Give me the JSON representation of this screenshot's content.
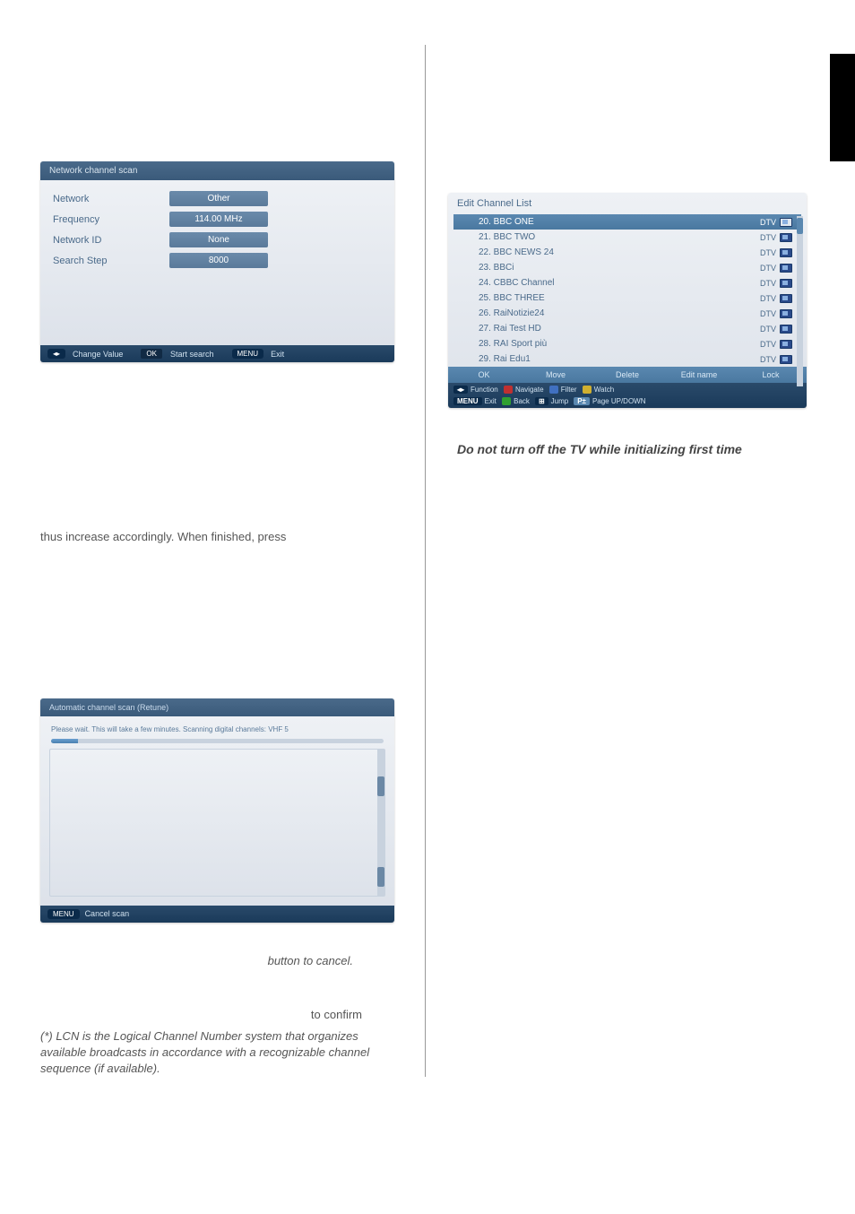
{
  "net_scan": {
    "title": "Network channel scan",
    "rows": [
      {
        "label": "Network",
        "value": "Other"
      },
      {
        "label": "Frequency",
        "value": "114.00 MHz"
      },
      {
        "label": "Network ID",
        "value": "None"
      },
      {
        "label": "Search Step",
        "value": "8000"
      }
    ],
    "footer": {
      "change_value": "Change Value",
      "start_search": "Start search",
      "exit": "Exit"
    }
  },
  "left_text": "thus increase accordingly. When finished, press",
  "auto_scan": {
    "title": "Automatic channel scan (Retune)",
    "msg": "Please wait. This will take a few minutes. Scanning digital channels: VHF 5",
    "footer": {
      "cancel_scan": "Cancel scan"
    }
  },
  "btn_cancel": "button to cancel.",
  "to_confirm": "to confirm",
  "lcn_note": "(*) LCN is the Logical Channel Number system that organizes available broadcasts in accordance with a recognizable channel sequence (if available).",
  "edit_list": {
    "title": "Edit Channel List",
    "channels": [
      {
        "name": "20. BBC ONE",
        "tag": "DTV",
        "selected": true
      },
      {
        "name": "21. BBC TWO",
        "tag": "DTV"
      },
      {
        "name": "22. BBC NEWS 24",
        "tag": "DTV"
      },
      {
        "name": "23. BBCi",
        "tag": "DTV"
      },
      {
        "name": "24. CBBC Channel",
        "tag": "DTV"
      },
      {
        "name": "25. BBC THREE",
        "tag": "DTV"
      },
      {
        "name": "26. RaiNotizie24",
        "tag": "DTV"
      },
      {
        "name": "27. Rai Test HD",
        "tag": "DTV"
      },
      {
        "name": "28. RAI Sport più",
        "tag": "DTV"
      },
      {
        "name": "29. Rai Edu1",
        "tag": "DTV"
      }
    ],
    "actions": [
      "OK",
      "Move",
      "Delete",
      "Edit name",
      "Lock"
    ],
    "footer": [
      {
        "label": "Function"
      },
      {
        "label": "Navigate"
      },
      {
        "label": "Filter"
      },
      {
        "label": "Watch"
      },
      {
        "label": "Exit"
      },
      {
        "label": "Back"
      },
      {
        "label": "Jump"
      },
      {
        "label": "Page UP/DOWN"
      }
    ]
  },
  "warning": "Do not turn off the TV while initializing first time"
}
